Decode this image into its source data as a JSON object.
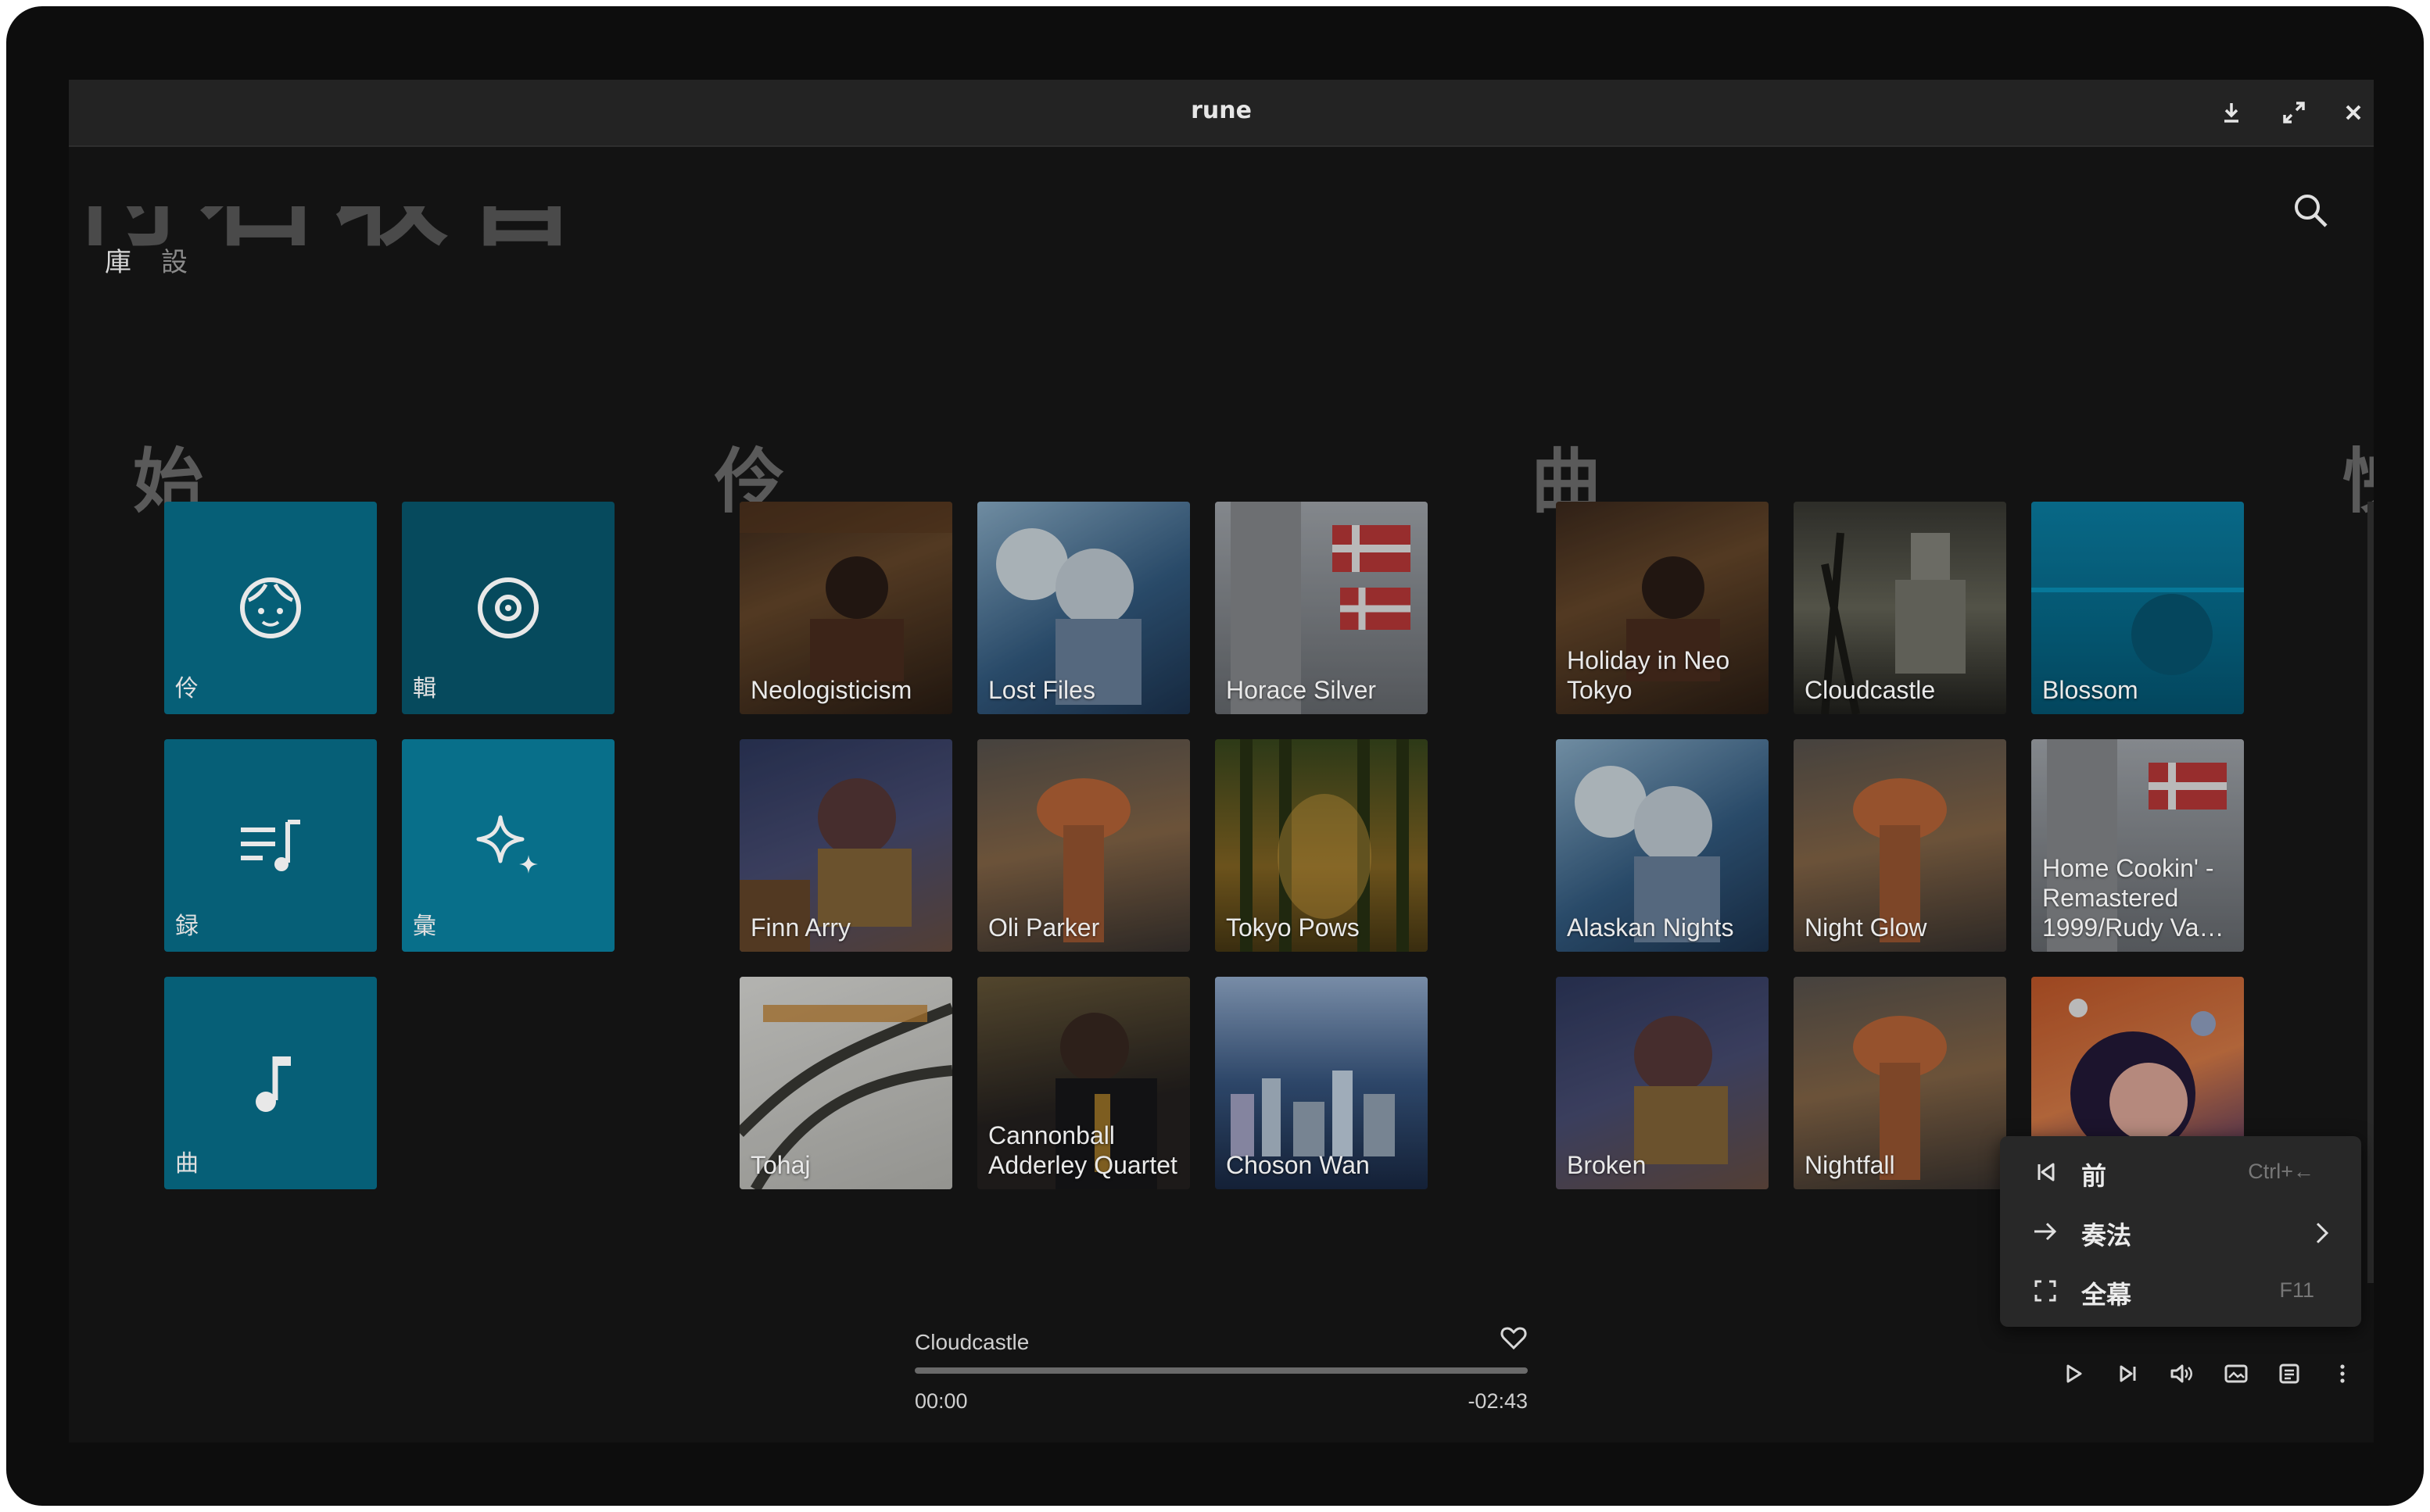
{
  "window": {
    "title": "rune",
    "big_title": "付石收音",
    "tabs": [
      "庫",
      "設"
    ]
  },
  "sections": [
    {
      "title": "始",
      "tiles": [
        {
          "label": "伶",
          "icon": "face-icon"
        },
        {
          "label": "輯",
          "icon": "disc-icon"
        },
        {
          "label": "録",
          "icon": "playlist-icon"
        },
        {
          "label": "彙",
          "icon": "sparkle-icon"
        },
        {
          "label": "曲",
          "icon": "music-note-icon"
        }
      ]
    },
    {
      "title": "伶",
      "cards": [
        "Neologisticism",
        "Lost Files",
        "Horace Silver",
        "Finn Arry",
        "Oli Parker",
        "Tokyo Pows",
        "Tohaj",
        "Cannonball Adderley Quartet",
        "Choson Wan"
      ]
    },
    {
      "title": "曲",
      "cards": [
        "Holiday in Neo Tokyo",
        "Cloudcastle",
        "Blossom",
        "Alaskan Nights",
        "Night Glow",
        "Home Cookin' - Remastered 1999/Rudy Va…",
        "Broken",
        "Nightfall",
        ""
      ]
    },
    {
      "title": "怏"
    }
  ],
  "player": {
    "track": "Cloudcastle",
    "elapsed": "00:00",
    "remaining": "-02:43",
    "progress_fraction": 0.0
  },
  "context_menu": {
    "items": [
      {
        "label": "前",
        "shortcut": "Ctrl+←",
        "icon": "previous-track-icon"
      },
      {
        "label": "奏法",
        "shortcut": "",
        "icon": "arrow-right-icon"
      },
      {
        "label": "全幕",
        "shortcut": "F11",
        "icon": "fullscreen-icon"
      }
    ]
  },
  "colors": {
    "tile_accent": "#065f77",
    "background": "#131313",
    "titlebar": "#232323",
    "menu": "#282828"
  }
}
